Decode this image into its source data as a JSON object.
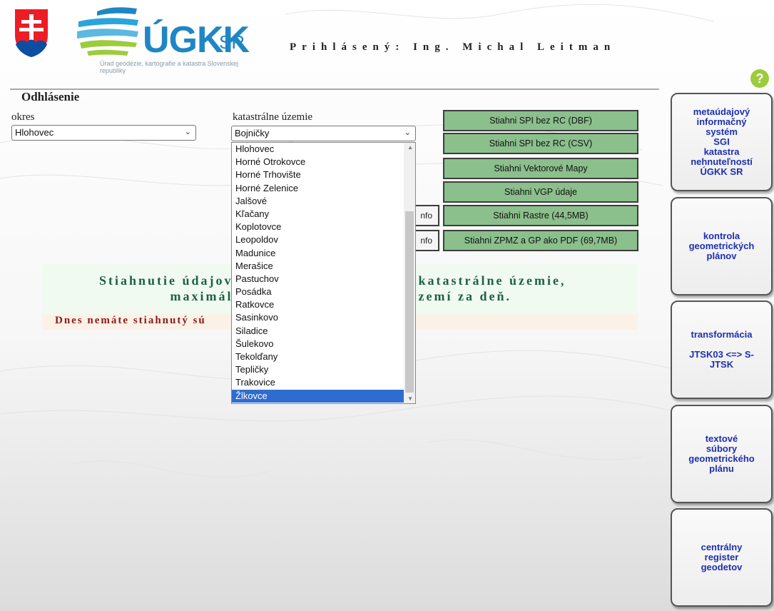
{
  "header": {
    "logo_text": "ÚGKK",
    "logo_suffix": "SR",
    "logo_subtitle": "Úrad geodézie, kartografie a katastra Slovenskej republiky",
    "logged_in": "Prihlásený: Ing. Michal Leitman",
    "help_label": "?",
    "logout_label": "Odhlásenie"
  },
  "form": {
    "okres_label": "okres",
    "okres_value": "Hlohovec",
    "ku_label": "katastrálne územie",
    "ku_value": "Bojničky"
  },
  "dropdown": {
    "items": [
      "Hlohovec",
      "Horné Otrokovce",
      "Horné Trhovište",
      "Horné Zelenice",
      "Jalšové",
      "Kľačany",
      "Koplotovce",
      "Leopoldov",
      "Madunice",
      "Merašice",
      "Pastuchov",
      "Posádka",
      "Ratkovce",
      "Sasinkovo",
      "Siladice",
      "Šulekovo",
      "Tekolďany",
      "Tepličky",
      "Trakovice",
      "Žlkovce"
    ],
    "selected": "Žlkovce"
  },
  "downloads": {
    "buttons": [
      "Stiahni SPI bez RC (DBF)",
      "Stiahni SPI bez RC (CSV)",
      "Stiahni Vektorové Mapy",
      "Stiahni VGP údaje",
      "Stiahni Rastre (44,5MB)",
      "Stiahni ZPMZ a GP ako PDF (69,7MB)"
    ],
    "info_label": "nfo"
  },
  "notice": {
    "line1_left": "Stiahnutie údajov",
    "line1_right": "katastrálne územie,",
    "line2_left": "maximál",
    "line2_right": "zemí za deň.",
    "warning": "Dnes nemáte stiahnutý sú"
  },
  "sidebar": {
    "buttons": [
      "metaúdajový\ninformačný\nsystém\nSGI\nkatastra\nnehnuteľností\nÚGKK SR",
      "kontrola\ngeometrických\nplánov",
      "transformácia\n\nJTSK03 <=> S-\nJTSK",
      "textové\nsúbory\ngeometrického\nplánu",
      "centrálny\nregister\ngeodetov"
    ]
  },
  "colors": {
    "accent_blue": "#1f86c5",
    "download_green": "#8bbf8c",
    "sidebar_text": "#1d2fb0",
    "selected_blue": "#2f6ccf",
    "warning_red": "#8a1b1b"
  }
}
